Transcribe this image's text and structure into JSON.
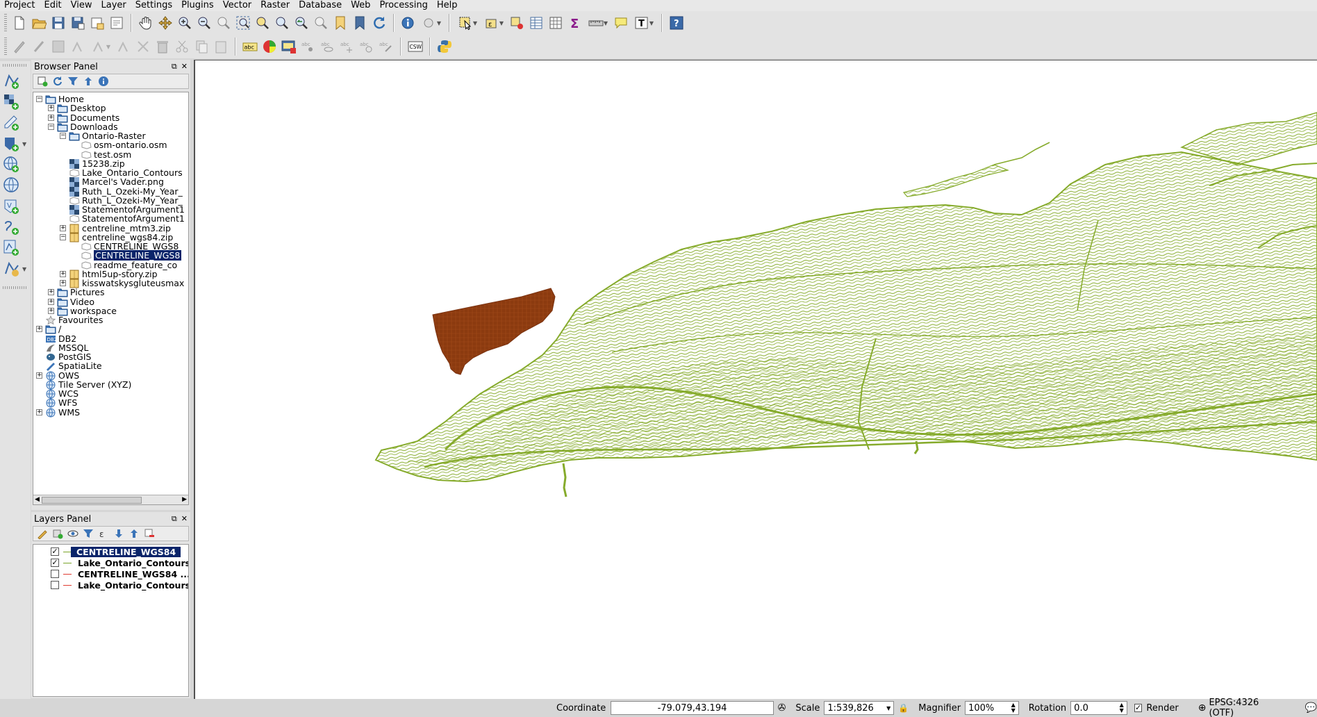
{
  "menu": [
    "Project",
    "Edit",
    "View",
    "Layer",
    "Settings",
    "Plugins",
    "Vector",
    "Raster",
    "Database",
    "Web",
    "Processing",
    "Help"
  ],
  "browser_panel": {
    "title": "Browser Panel",
    "items": [
      {
        "label": "Home",
        "type": "folder",
        "level": 0,
        "expander": "minus"
      },
      {
        "label": "Desktop",
        "type": "folder",
        "level": 1,
        "expander": "plus"
      },
      {
        "label": "Documents",
        "type": "folder",
        "level": 1,
        "expander": "plus"
      },
      {
        "label": "Downloads",
        "type": "folder",
        "level": 1,
        "expander": "minus"
      },
      {
        "label": "Ontario-Raster",
        "type": "folder",
        "level": 2,
        "expander": "minus"
      },
      {
        "label": "osm-ontario.osm",
        "type": "vector",
        "level": 3,
        "expander": ""
      },
      {
        "label": "test.osm",
        "type": "vector",
        "level": 3,
        "expander": ""
      },
      {
        "label": "15238.zip",
        "type": "raster",
        "level": 2,
        "expander": ""
      },
      {
        "label": "Lake_Ontario_Contours",
        "type": "vector",
        "level": 2,
        "expander": ""
      },
      {
        "label": "Marcel's Vader.png",
        "type": "raster",
        "level": 2,
        "expander": ""
      },
      {
        "label": "Ruth_L_Ozeki-My_Year_",
        "type": "raster",
        "level": 2,
        "expander": ""
      },
      {
        "label": "Ruth_L_Ozeki-My_Year_",
        "type": "vector",
        "level": 2,
        "expander": ""
      },
      {
        "label": "StatementofArgument1",
        "type": "raster",
        "level": 2,
        "expander": ""
      },
      {
        "label": "StatementofArgument1",
        "type": "vector",
        "level": 2,
        "expander": ""
      },
      {
        "label": "centreline_mtm3.zip",
        "type": "zip",
        "level": 2,
        "expander": "plus"
      },
      {
        "label": "centreline_wgs84.zip",
        "type": "zip",
        "level": 2,
        "expander": "minus"
      },
      {
        "label": "CENTRELINE_WGS8",
        "type": "vector",
        "level": 3,
        "expander": ""
      },
      {
        "label": "CENTRELINE_WGS8",
        "type": "vector",
        "level": 3,
        "expander": "",
        "selected": true
      },
      {
        "label": "readme_feature_co",
        "type": "vector",
        "level": 3,
        "expander": ""
      },
      {
        "label": "html5up-story.zip",
        "type": "zip",
        "level": 2,
        "expander": "plus"
      },
      {
        "label": "kisswatskysgluteusmax",
        "type": "zip",
        "level": 2,
        "expander": "plus"
      },
      {
        "label": "Pictures",
        "type": "folder",
        "level": 1,
        "expander": "plus"
      },
      {
        "label": "Video",
        "type": "folder",
        "level": 1,
        "expander": "plus"
      },
      {
        "label": "workspace",
        "type": "folder",
        "level": 1,
        "expander": "plus"
      },
      {
        "label": "Favourites",
        "type": "star",
        "level": 0,
        "expander": ""
      },
      {
        "label": "/",
        "type": "folder",
        "level": 0,
        "expander": "plus"
      },
      {
        "label": "DB2",
        "type": "db2",
        "level": 0,
        "expander": ""
      },
      {
        "label": "MSSQL",
        "type": "mssql",
        "level": 0,
        "expander": ""
      },
      {
        "label": "PostGIS",
        "type": "postgis",
        "level": 0,
        "expander": ""
      },
      {
        "label": "SpatiaLite",
        "type": "spatialite",
        "level": 0,
        "expander": ""
      },
      {
        "label": "OWS",
        "type": "globe",
        "level": 0,
        "expander": "plus"
      },
      {
        "label": "Tile Server (XYZ)",
        "type": "globe",
        "level": 0,
        "expander": ""
      },
      {
        "label": "WCS",
        "type": "globe",
        "level": 0,
        "expander": ""
      },
      {
        "label": "WFS",
        "type": "globe",
        "level": 0,
        "expander": ""
      },
      {
        "label": "WMS",
        "type": "globe",
        "level": 0,
        "expander": "plus"
      }
    ]
  },
  "layers_panel": {
    "title": "Layers Panel",
    "layers": [
      {
        "label": "CENTRELINE_WGS84",
        "checked": true,
        "color": "#7aa52a",
        "selected": true
      },
      {
        "label": "Lake_Ontario_Contours",
        "checked": true,
        "color": "#7aa52a",
        "selected": false
      },
      {
        "label": "CENTRELINE_WGS84 ...",
        "checked": false,
        "color": "#e03c31",
        "selected": false
      },
      {
        "label": "Lake_Ontario_Contours",
        "checked": false,
        "color": "#e03c31",
        "selected": false
      }
    ]
  },
  "status": {
    "coordinate_label": "Coordinate",
    "coordinate_value": "-79.079,43.194",
    "scale_label": "Scale",
    "scale_value": "1:539,826",
    "magnifier_label": "Magnifier",
    "magnifier_value": "100%",
    "rotation_label": "Rotation",
    "rotation_value": "0.0",
    "render_label": "Render",
    "render_checked": true,
    "crs": "EPSG:4326 (OTF)"
  },
  "toolbar_labels": {
    "abc": "abc",
    "csw": "CSW"
  },
  "colors": {
    "contours": "#86ab2c",
    "centreline": "#8b3a0f",
    "selection": "#0a246a"
  }
}
